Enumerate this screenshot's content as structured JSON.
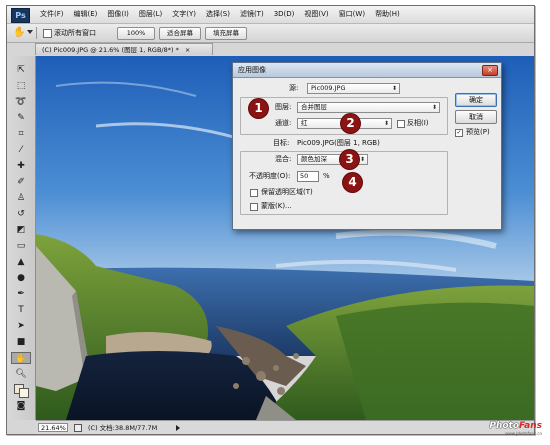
{
  "app": {
    "logo": "Ps"
  },
  "menubar": {
    "items": [
      "文件(F)",
      "编辑(E)",
      "图像(I)",
      "图层(L)",
      "文字(Y)",
      "选择(S)",
      "滤镜(T)",
      "3D(D)",
      "视图(V)",
      "窗口(W)",
      "帮助(H)"
    ]
  },
  "options_bar": {
    "tool_icon": "hand-icon",
    "scroll_all_label": "滚动所有窗口",
    "btn_100": "100%",
    "btn_fit": "适合屏幕",
    "btn_fill": "填充屏幕"
  },
  "document": {
    "tab_title": "(C) Pic009.JPG @ 21.6% (图层 1, RGB/8*) *",
    "tab_close": "×"
  },
  "status_bar": {
    "zoom": "21.64%",
    "doc_info": "(C) 文档:38.8M/77.7M"
  },
  "toolbox": {
    "tools": [
      "move-icon",
      "marquee-icon",
      "lasso-icon",
      "quick-select-icon",
      "crop-icon",
      "eyedropper-icon",
      "healing-brush-icon",
      "brush-icon",
      "clone-stamp-icon",
      "history-brush-icon",
      "eraser-icon",
      "gradient-icon",
      "blur-icon",
      "dodge-icon",
      "pen-icon",
      "type-icon",
      "path-select-icon",
      "shape-icon",
      "hand-icon",
      "zoom-icon",
      "color-swatches-icon",
      "quick-mask-icon",
      "screen-mode-icon"
    ]
  },
  "dialog": {
    "title": "应用图像",
    "close": "×",
    "source_label": "源:",
    "source_value": "Pic009.JPG",
    "layer_label": "图层:",
    "layer_value": "合并图层",
    "channel_label": "通道:",
    "channel_value": "红",
    "invert_label": "反相(I)",
    "target_label": "目标:",
    "target_value": "Pic009.JPG(图层 1, RGB)",
    "blending_label": "混合:",
    "blending_value": "颜色加深",
    "opacity_label": "不透明度(O):",
    "opacity_value": "50",
    "opacity_unit": "%",
    "preserve_transparency_label": "保留透明区域(T)",
    "mask_label": "蒙版(K)...",
    "ok": "确定",
    "cancel": "取消",
    "preview_label": "预览(P)",
    "preview_checked": "✓"
  },
  "annotations": {
    "m1": "1",
    "m2": "2",
    "m3": "3",
    "m4": "4",
    "color": "#8c1313"
  },
  "watermark": {
    "part1": "Photo",
    "part2": "Fans",
    "sub": "www.photofans.cn"
  }
}
